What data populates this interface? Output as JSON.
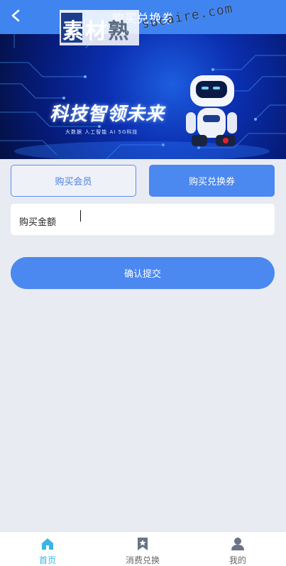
{
  "header": {
    "title": "购买兑换券",
    "back_icon": "chevron-left-icon",
    "bg_color": "#3f84ef"
  },
  "banner": {
    "headline": "科技智领未来",
    "subline": "大数据   人工智能   AI   5G科技",
    "watermark_logo_main": "素材",
    "watermark_logo_sub": "熟",
    "watermark_url": "sucaire.com"
  },
  "tabs": [
    {
      "label": "购买会员",
      "active": false
    },
    {
      "label": "购买兑换券",
      "active": true
    }
  ],
  "amount": {
    "label": "购买金额",
    "value": "",
    "placeholder": ""
  },
  "submit": {
    "label": "确认提交"
  },
  "bottom_nav": {
    "items": [
      {
        "label": "首页",
        "icon": "home-icon",
        "active": true
      },
      {
        "label": "消费兑换",
        "icon": "bookmark-icon",
        "active": false
      },
      {
        "label": "我的",
        "icon": "user-icon",
        "active": false
      }
    ]
  },
  "colors": {
    "accent": "#4b88ef",
    "active_nav": "#39b5e8",
    "page_bg": "#e9ebf3"
  }
}
